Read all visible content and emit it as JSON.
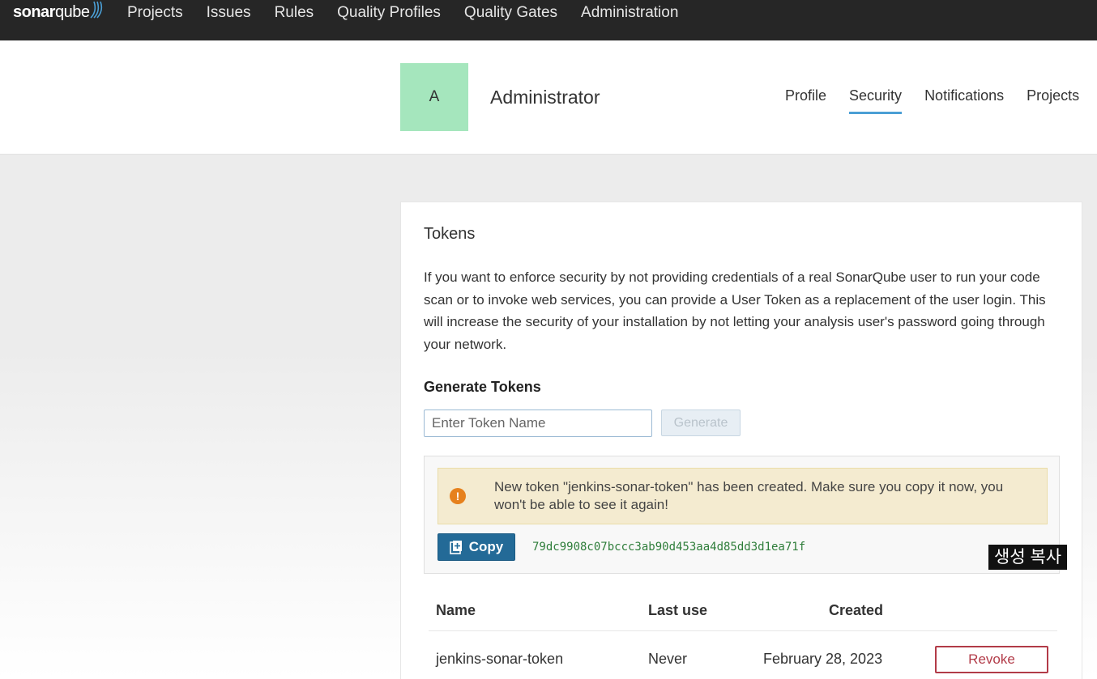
{
  "brand": {
    "logo_sonar": "sonar",
    "logo_qube": "qube"
  },
  "nav": {
    "items": [
      {
        "label": "Projects"
      },
      {
        "label": "Issues"
      },
      {
        "label": "Rules"
      },
      {
        "label": "Quality Profiles"
      },
      {
        "label": "Quality Gates"
      },
      {
        "label": "Administration"
      }
    ]
  },
  "account": {
    "avatar_letter": "A",
    "avatar_color": "#a5e6bd",
    "name": "Administrator",
    "tabs": [
      {
        "label": "Profile",
        "active": false
      },
      {
        "label": "Security",
        "active": true
      },
      {
        "label": "Notifications",
        "active": false
      },
      {
        "label": "Projects",
        "active": false
      }
    ]
  },
  "tokens": {
    "title": "Tokens",
    "description": "If you want to enforce security by not providing credentials of a real SonarQube user to run your code scan or to invoke web services, you can provide a User Token as a replacement of the user login. This will increase the security of your installation by not letting your analysis user's password going through your network.",
    "generate_title": "Generate Tokens",
    "input_placeholder": "Enter Token Name",
    "generate_label": "Generate",
    "alert_message": "New token \"jenkins-sonar-token\" has been created. Make sure you copy it now, you won't be able to see it again!",
    "copy_label": "Copy",
    "token_value": "79dc9908c07bccc3ab90d453aa4d85dd3d1ea71f",
    "table": {
      "headers": {
        "name": "Name",
        "last_use": "Last use",
        "created": "Created"
      },
      "rows": [
        {
          "name": "jenkins-sonar-token",
          "last_use": "Never",
          "created": "February 28, 2023",
          "action": "Revoke"
        }
      ]
    }
  },
  "overlay": {
    "caption": "생성 복사"
  },
  "colors": {
    "nav_bg": "#262626",
    "accent": "#4b9fd5",
    "copy_button": "#236a97",
    "revoke": "#b23b48",
    "warning_bg": "#f4ebd0",
    "warning_icon": "#e6811d",
    "token_text": "#2e7d3a"
  }
}
